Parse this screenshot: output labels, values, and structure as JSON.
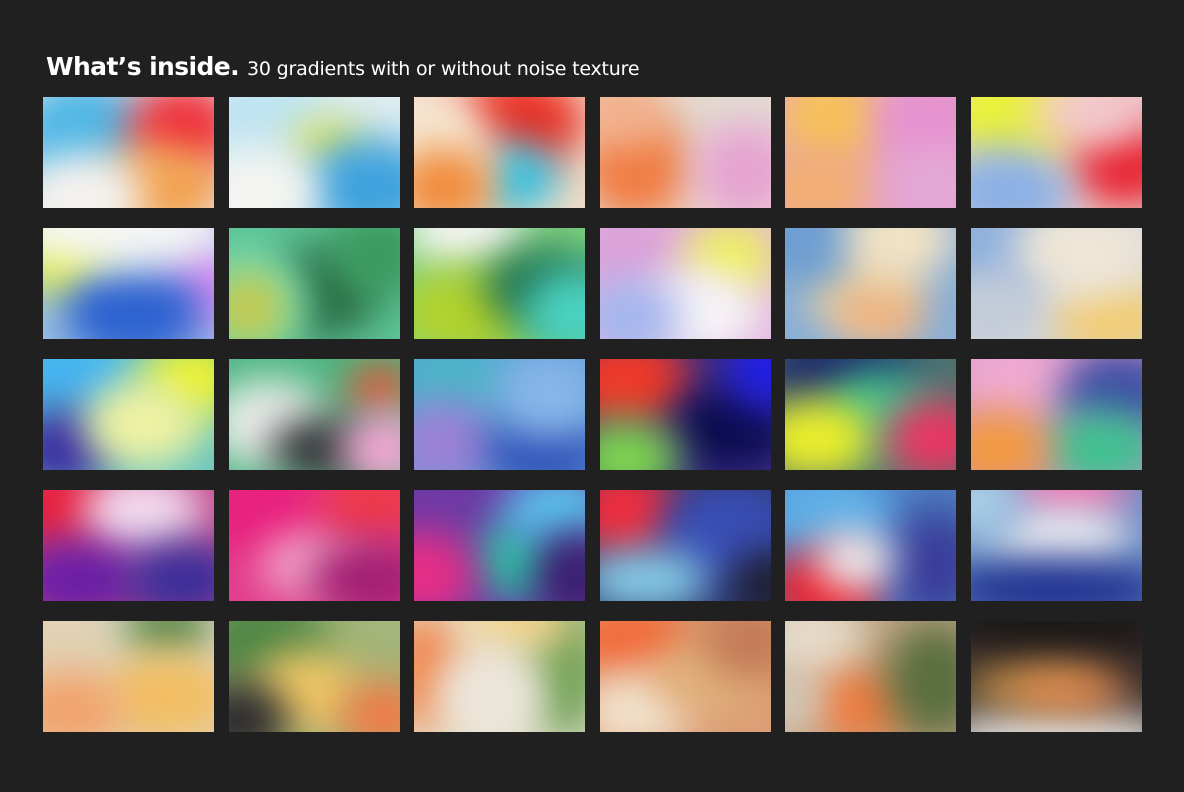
{
  "header": {
    "title": "What’s inside.",
    "subtitle": "30 gradients with or without noise texture"
  },
  "gradients": [
    {
      "name": "gradient-01",
      "base": "#eeeaea",
      "blobs": [
        {
          "c": "#4db6e6"
        },
        {
          "c": "#ee2d3a"
        },
        {
          "c": "#f2a24e"
        },
        {
          "c": "#f6f2ee"
        }
      ]
    },
    {
      "name": "gradient-02",
      "base": "#dfeef3",
      "blobs": [
        {
          "c": "#bfe4f2"
        },
        {
          "c": "#f2e93a"
        },
        {
          "c": "#3ea2dd"
        },
        {
          "c": "#f4f4f0"
        }
      ]
    },
    {
      "name": "gradient-03",
      "base": "#f2dcc6",
      "blobs": [
        {
          "c": "#ea2f24"
        },
        {
          "c": "#2fc6e8"
        },
        {
          "c": "#f6ead6"
        },
        {
          "c": "#f08a3a"
        }
      ]
    },
    {
      "name": "gradient-04",
      "base": "#ecdcd0",
      "blobs": [
        {
          "c": "#e3dcd3"
        },
        {
          "c": "#f07c42"
        },
        {
          "c": "#e6a2d2"
        },
        {
          "c": "#f2b08c"
        }
      ]
    },
    {
      "name": "gradient-05",
      "base": "#e4a2c8",
      "blobs": [
        {
          "c": "#f6c25a"
        },
        {
          "c": "#e692d0"
        },
        {
          "c": "#f2ae72"
        },
        {
          "c": "#e4a8d8"
        }
      ]
    },
    {
      "name": "gradient-06",
      "base": "#ecd2ce",
      "blobs": [
        {
          "c": "#eaf23a"
        },
        {
          "c": "#e8202e"
        },
        {
          "c": "#8ab0e6"
        },
        {
          "c": "#f2c8d0"
        }
      ]
    },
    {
      "name": "gradient-07",
      "base": "#9cc2e6",
      "blobs": [
        {
          "c": "#e6f22c"
        },
        {
          "c": "#d88af2"
        },
        {
          "c": "#2e62d0"
        },
        {
          "c": "#f6f6f4"
        }
      ]
    },
    {
      "name": "gradient-08",
      "base": "#5ec496",
      "blobs": [
        {
          "c": "#2a6840"
        },
        {
          "c": "#6ee0c2"
        },
        {
          "c": "#c6c84c"
        },
        {
          "c": "#3a9a5e"
        }
      ]
    },
    {
      "name": "gradient-09",
      "base": "#7ed07e",
      "blobs": [
        {
          "c": "#f4f4f2"
        },
        {
          "c": "#b4d22c"
        },
        {
          "c": "#1e6e4e"
        },
        {
          "c": "#4ad2c2"
        }
      ]
    },
    {
      "name": "gradient-10",
      "base": "#e2b6e0",
      "blobs": [
        {
          "c": "#dca2d8"
        },
        {
          "c": "#eef05a"
        },
        {
          "c": "#f6f4f8"
        },
        {
          "c": "#a2b6ee"
        }
      ]
    },
    {
      "name": "gradient-11",
      "base": "#8ab0d8",
      "blobs": [
        {
          "c": "#f2d8a0"
        },
        {
          "c": "#f0b482"
        },
        {
          "c": "#6e9ed2"
        },
        {
          "c": "#f6e4c4"
        }
      ]
    },
    {
      "name": "gradient-12",
      "base": "#d8d8dc",
      "blobs": [
        {
          "c": "#8aaede"
        },
        {
          "c": "#f2cc72"
        },
        {
          "c": "#eee6d6"
        },
        {
          "c": "#c4ccd8"
        }
      ]
    },
    {
      "name": "gradient-13",
      "base": "#6ac6c0",
      "blobs": [
        {
          "c": "#44b4f2"
        },
        {
          "c": "#eef22a"
        },
        {
          "c": "#3a2aa2"
        },
        {
          "c": "#f0f2a2"
        }
      ]
    },
    {
      "name": "gradient-14",
      "base": "#4cb682",
      "blobs": [
        {
          "c": "#eeeeec"
        },
        {
          "c": "#f24a2c"
        },
        {
          "c": "#2a2a2e"
        },
        {
          "c": "#f2a6d2"
        }
      ]
    },
    {
      "name": "gradient-15",
      "base": "#5e9ed8",
      "blobs": [
        {
          "c": "#4ab6c6"
        },
        {
          "c": "#9c82d6"
        },
        {
          "c": "#2e4eb6"
        },
        {
          "c": "#88b6e8"
        }
      ]
    },
    {
      "name": "gradient-16",
      "base": "#3a2e86",
      "blobs": [
        {
          "c": "#ee3a2a"
        },
        {
          "c": "#0c0c4e"
        },
        {
          "c": "#1e1eee"
        },
        {
          "c": "#7ed64e"
        }
      ]
    },
    {
      "name": "gradient-17",
      "base": "#4e7270",
      "blobs": [
        {
          "c": "#1e2a6e"
        },
        {
          "c": "#3ec290"
        },
        {
          "c": "#eef02a"
        },
        {
          "c": "#ee3462"
        }
      ]
    },
    {
      "name": "gradient-18",
      "base": "#d094c6",
      "blobs": [
        {
          "c": "#eeaad2"
        },
        {
          "c": "#3e4ea6"
        },
        {
          "c": "#3ec290"
        },
        {
          "c": "#f29a3e"
        }
      ]
    },
    {
      "name": "gradient-19",
      "base": "#c04a8e",
      "blobs": [
        {
          "c": "#e8203e"
        },
        {
          "c": "#f4dcee"
        },
        {
          "c": "#6a1ea6"
        },
        {
          "c": "#3a2e9a"
        }
      ]
    },
    {
      "name": "gradient-20",
      "base": "#e23e8e",
      "blobs": [
        {
          "c": "#e8207e"
        },
        {
          "c": "#f2a8c8"
        },
        {
          "c": "#ee3a4a"
        },
        {
          "c": "#a21e72"
        }
      ]
    },
    {
      "name": "gradient-21",
      "base": "#6e3aa6",
      "blobs": [
        {
          "c": "#2ebea2"
        },
        {
          "c": "#e82e86"
        },
        {
          "c": "#5ac2ee"
        },
        {
          "c": "#3a1e6e"
        }
      ]
    },
    {
      "name": "gradient-22",
      "base": "#2e3a6e",
      "blobs": [
        {
          "c": "#ee2e3e"
        },
        {
          "c": "#3a4eb6"
        },
        {
          "c": "#8ad2ee"
        },
        {
          "c": "#1e1e2e"
        }
      ]
    },
    {
      "name": "gradient-23",
      "base": "#4e7ec2",
      "blobs": [
        {
          "c": "#5eaee6"
        },
        {
          "c": "#ee1e2a"
        },
        {
          "c": "#3a3e9a"
        },
        {
          "c": "#f2f2f2"
        }
      ]
    },
    {
      "name": "gradient-24",
      "base": "#6a8ec6",
      "blobs": [
        {
          "c": "#ee7ab2"
        },
        {
          "c": "#f6f6f6"
        },
        {
          "c": "#1e2e8e"
        },
        {
          "c": "#aacfe6"
        }
      ]
    },
    {
      "name": "gradient-25",
      "base": "#e2d2b6",
      "blobs": [
        {
          "c": "#e6e0ce"
        },
        {
          "c": "#5e8a4e"
        },
        {
          "c": "#f2be62"
        },
        {
          "c": "#f2a26a"
        }
      ]
    },
    {
      "name": "gradient-26",
      "base": "#a4b67a",
      "blobs": [
        {
          "c": "#4e8646"
        },
        {
          "c": "#f2c866"
        },
        {
          "c": "#2e2a2e"
        },
        {
          "c": "#f27a46"
        }
      ]
    },
    {
      "name": "gradient-27",
      "base": "#e6e2d2",
      "blobs": [
        {
          "c": "#f08a52"
        },
        {
          "c": "#72a256"
        },
        {
          "c": "#f2d28a"
        },
        {
          "c": "#ece6da"
        }
      ]
    },
    {
      "name": "gradient-28",
      "base": "#dc9e76",
      "blobs": [
        {
          "c": "#f26a3a"
        },
        {
          "c": "#f2e2ce"
        },
        {
          "c": "#e2b47e"
        },
        {
          "c": "#c27a56"
        }
      ]
    },
    {
      "name": "gradient-29",
      "base": "#c2a686",
      "blobs": [
        {
          "c": "#e6dcca"
        },
        {
          "c": "#f27a3e"
        },
        {
          "c": "#5a6e3e"
        },
        {
          "c": "#d2c6b6"
        }
      ]
    },
    {
      "name": "gradient-30",
      "base": "#3a302e",
      "blobs": [
        {
          "c": "#1e1a1a"
        },
        {
          "c": "#eeeeec"
        },
        {
          "c": "#f2b24e"
        },
        {
          "c": "#f28a52"
        }
      ]
    }
  ]
}
